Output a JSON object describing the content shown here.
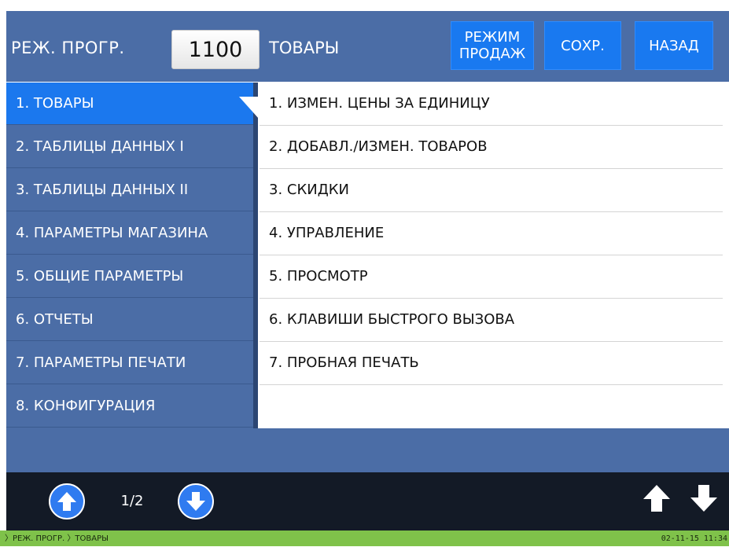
{
  "header": {
    "mode_label": "РЕЖ. ПРОГР.",
    "mode_code": "1100",
    "section_title": "ТОВАРЫ",
    "buttons": {
      "sales_mode": "РЕЖИМ\nПРОДАЖ",
      "save": "СОХР.",
      "back": "НАЗАД"
    }
  },
  "sidebar": {
    "active_index": 0,
    "items": [
      {
        "label": "1. ТОВАРЫ"
      },
      {
        "label": "2. ТАБЛИЦЫ ДАННЫХ I"
      },
      {
        "label": "3. ТАБЛИЦЫ ДАННЫХ II"
      },
      {
        "label": "4. ПАРАМЕТРЫ МАГАЗИНА"
      },
      {
        "label": "5. ОБЩИЕ ПАРАМЕТРЫ"
      },
      {
        "label": "6. ОТЧЕТЫ"
      },
      {
        "label": "7. ПАРАМЕТРЫ ПЕЧАТИ"
      },
      {
        "label": "8. КОНФИГУРАЦИЯ"
      }
    ]
  },
  "content": {
    "items": [
      {
        "label": "1. ИЗМЕН. ЦЕНЫ ЗА ЕДИНИЦУ"
      },
      {
        "label": "2. ДОБАВЛ./ИЗМЕН. ТОВАРОВ"
      },
      {
        "label": "3. СКИДКИ"
      },
      {
        "label": "4. УПРАВЛЕНИЕ"
      },
      {
        "label": "5. ПРОСМОТР"
      },
      {
        "label": "6. КЛАВИШИ БЫСТРОГО ВЫЗОВА"
      },
      {
        "label": "7. ПРОБНАЯ ПЕЧАТЬ"
      }
    ]
  },
  "nav": {
    "page_indicator": "1/2",
    "icons": {
      "page_up": "arrow-up-circle-icon",
      "page_down": "arrow-down-circle-icon",
      "scroll_up": "arrow-up-icon",
      "scroll_down": "arrow-down-icon"
    }
  },
  "status": {
    "breadcrumb": "〉РЕЖ. ПРОГР. 〉ТОВАРЫ",
    "datetime": "02-11-15 11:34"
  },
  "colors": {
    "panel_blue": "#4b6da6",
    "button_blue": "#1979f0",
    "active_item": "#1b78ee",
    "nav_dark": "#131a26",
    "status_green": "#7fc24a"
  }
}
